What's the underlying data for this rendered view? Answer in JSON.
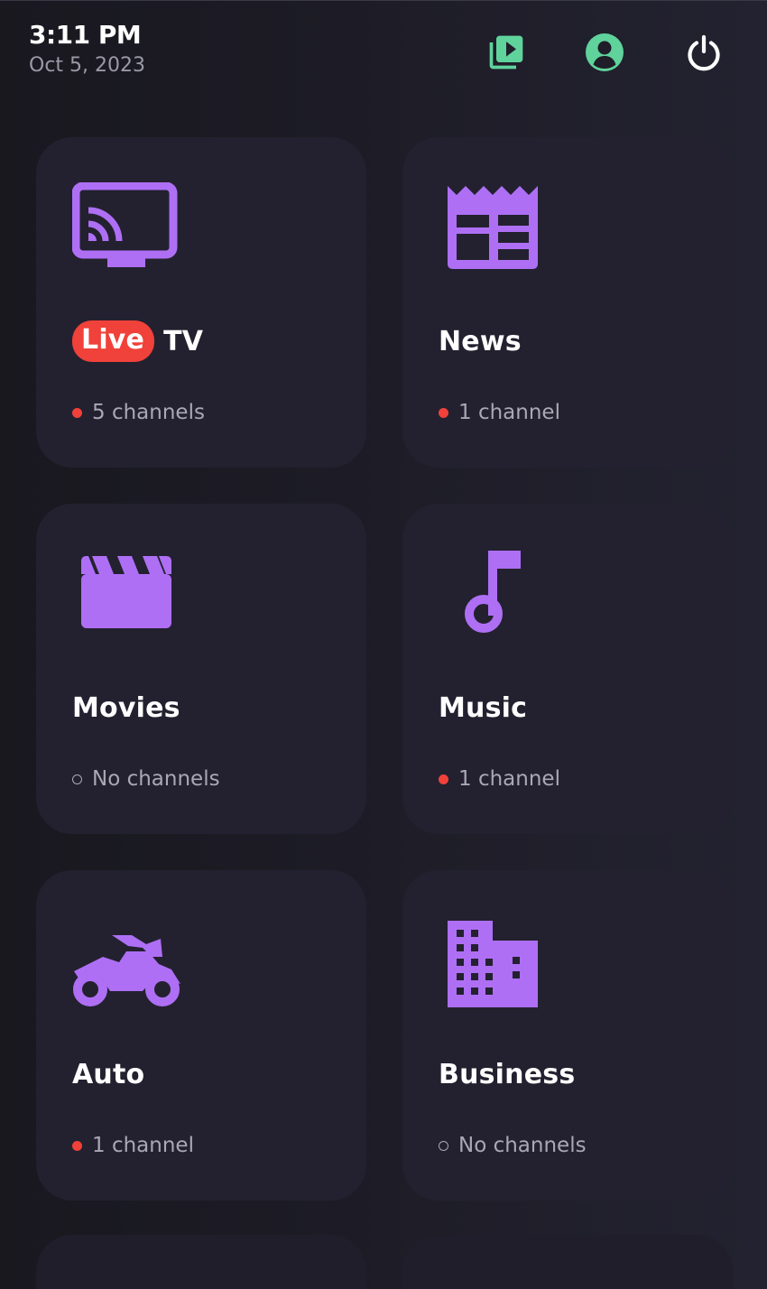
{
  "header": {
    "time": "3:11 PM",
    "date": "Oct 5, 2023",
    "icons": [
      "video-library-icon",
      "account-icon",
      "power-icon"
    ],
    "accent_color": "#5fd39b"
  },
  "categories": [
    {
      "id": "live-tv",
      "badge": "Live",
      "label": "TV",
      "status": "5 channels",
      "active": true,
      "icon": "cast-tv-icon"
    },
    {
      "id": "news",
      "badge": "",
      "label": "News",
      "status": "1 channel",
      "active": true,
      "icon": "newspaper-icon"
    },
    {
      "id": "movies",
      "badge": "",
      "label": "Movies",
      "status": "No channels",
      "active": false,
      "icon": "clapperboard-icon"
    },
    {
      "id": "music",
      "badge": "",
      "label": "Music",
      "status": "1 channel",
      "active": true,
      "icon": "music-note-icon"
    },
    {
      "id": "auto",
      "badge": "",
      "label": "Auto",
      "status": "1 channel",
      "active": true,
      "icon": "motorcycle-icon"
    },
    {
      "id": "business",
      "badge": "",
      "label": "Business",
      "status": "No channels",
      "active": false,
      "icon": "office-building-icon"
    }
  ],
  "colors": {
    "icon_purple": "#ae6ff5",
    "live_red": "#f0413a",
    "card_bg": "#23212f"
  }
}
